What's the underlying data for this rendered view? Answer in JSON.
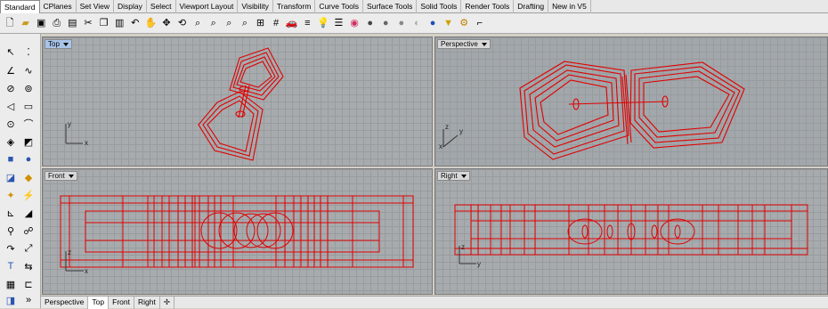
{
  "ribbon_tabs": [
    "Standard",
    "CPlanes",
    "Set View",
    "Display",
    "Select",
    "Viewport Layout",
    "Visibility",
    "Transform",
    "Curve Tools",
    "Surface Tools",
    "Solid Tools",
    "Render Tools",
    "Drafting",
    "New in V5"
  ],
  "active_ribbon_tab": "Standard",
  "toolbar_icons": [
    "new-icon",
    "open-icon",
    "save-icon",
    "print-icon",
    "import-icon",
    "cut-icon",
    "copy-icon",
    "paste-icon",
    "undo-icon",
    "pan-hand-icon",
    "move-icon",
    "rotate-view-icon",
    "zoom-window-icon",
    "zoom-dynamic-icon",
    "zoom-extents-icon",
    "zoom-selected-icon",
    "four-viewports-icon",
    "grid-icon",
    "car-icon",
    "layers-icon",
    "light-bulb-icon",
    "properties-icon",
    "color-wheel-icon",
    "shaded-sphere-icon",
    "render-sphere-icon",
    "gray-sphere-icon",
    "ghost-sphere-icon",
    "blue-sphere-icon",
    "render-icon",
    "settings-gear-icon",
    "options-icon"
  ],
  "viewports": {
    "top": {
      "label": "Top",
      "axis_x": "x",
      "axis_y": "y"
    },
    "perspective": {
      "label": "Perspective",
      "axis_x": "x",
      "axis_y": "y",
      "axis_z": "z"
    },
    "front": {
      "label": "Front",
      "axis_x": "x",
      "axis_z": "z"
    },
    "right": {
      "label": "Right",
      "axis_y": "y",
      "axis_z": "z"
    }
  },
  "bottom_tabs": [
    "Perspective",
    "Top",
    "Front",
    "Right"
  ],
  "active_bottom_tab": "Top",
  "add_tab_symbol": "✢",
  "colors": {
    "wire_red": "#e00000",
    "viewport_bg": "#a7abae",
    "active_label": "#a9c4e8"
  }
}
